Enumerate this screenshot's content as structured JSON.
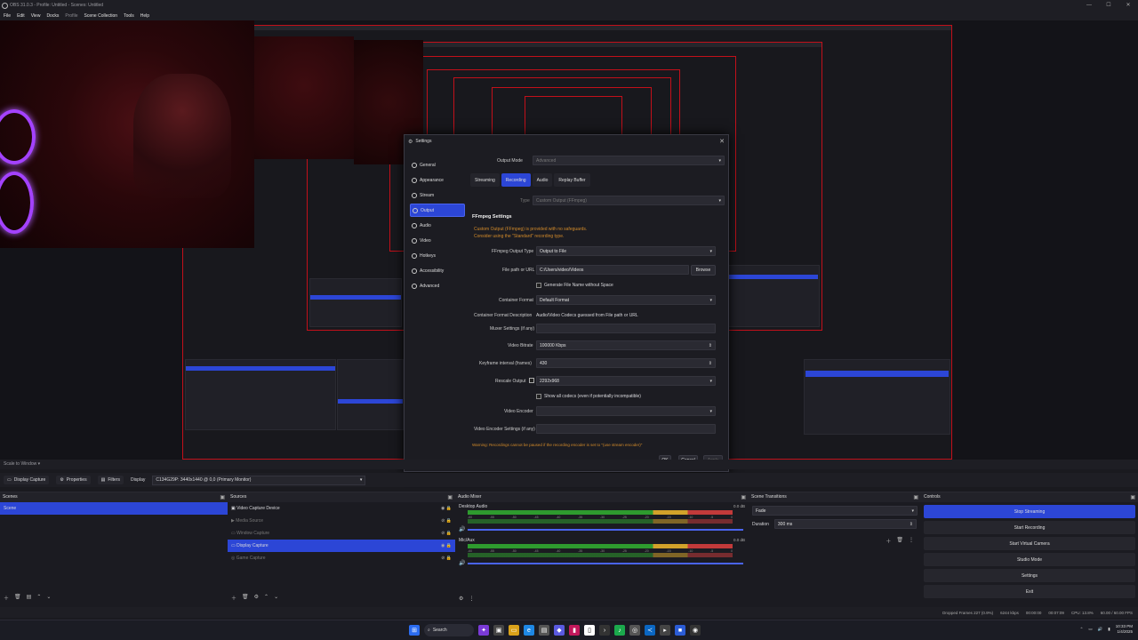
{
  "window": {
    "title": "OBS 31.0.3 - Profile: Untitled - Scenes: Untitled",
    "controls": [
      "—",
      "☐",
      "✕"
    ]
  },
  "menu": [
    {
      "label": "File"
    },
    {
      "label": "Edit"
    },
    {
      "label": "View"
    },
    {
      "label": "Docks"
    },
    {
      "label": "Profile",
      "dim": true
    },
    {
      "label": "Scene Collection"
    },
    {
      "label": "Tools"
    },
    {
      "label": "Help"
    }
  ],
  "settings": {
    "title": "Settings",
    "nav": [
      "General",
      "Appearance",
      "Stream",
      "Output",
      "Audio",
      "Video",
      "Hotkeys",
      "Accessibility",
      "Advanced"
    ],
    "active_nav": "Output",
    "output_mode_label": "Output Mode",
    "output_mode_value": "Advanced",
    "tabs": [
      "Streaming",
      "Recording",
      "Audio",
      "Replay Buffer"
    ],
    "active_tab": "Recording",
    "type_label": "Type",
    "type_value": "Custom Output (FFmpeg)",
    "section": "FFmpeg Settings",
    "warning1": "Custom Output (FFmpeg) is provided with no safeguards.",
    "warning2": "Consider using the \"Standard\" recording type.",
    "ffmpeg_output_type_label": "FFmpeg Output Type",
    "ffmpeg_output_type_value": "Output to File",
    "file_path_label": "File path or URL",
    "file_path_value": "C:/Users/video/Videos",
    "browse": "Browse",
    "gen_filename": "Generate File Name without Space",
    "container_format_label": "Container Format",
    "container_format_value": "Default Format",
    "container_desc_label": "Container Format Description",
    "container_desc_value": "Audio/Video Codecs guessed from File path or URL",
    "muxer_label": "Muxer Settings (if any)",
    "video_bitrate_label": "Video Bitrate",
    "video_bitrate_value": "100000 Kbps",
    "keyframe_label": "Keyframe interval (frames)",
    "keyframe_value": "430",
    "rescale_label": "Rescale Output",
    "rescale_value": "2292x968",
    "show_all_codecs": "Show all codecs (even if potentially incompatible)",
    "video_encoder_label": "Video Encoder",
    "video_encoder_settings_label": "Video Encoder Settings (if any)",
    "footer_warning": "Warning: Recordings cannot be paused if the recording encoder is set to \"(use stream encoder)\"",
    "ok": "OK",
    "cancel": "Cancel",
    "apply": "Apply"
  },
  "scale_label": "Scale to Window",
  "source_toolbar": {
    "source": "Display Capture",
    "properties": "Properties",
    "filters": "Filters",
    "display_label": "Display",
    "display_value": "C134G29P: 3440x1440 @ 0,0 (Primary Monitor)"
  },
  "scenes": {
    "title": "Scenes",
    "items": [
      "Scene"
    ]
  },
  "sources": {
    "title": "Sources",
    "items": [
      {
        "label": "Video Capture Device",
        "dim": false
      },
      {
        "label": "Media Source",
        "dim": true
      },
      {
        "label": "Window Capture",
        "dim": true
      },
      {
        "label": "Display Capture",
        "dim": false,
        "selected": true
      },
      {
        "label": "Game Capture",
        "dim": true
      }
    ]
  },
  "audio": {
    "title": "Audio Mixer",
    "channels": [
      {
        "name": "Desktop Audio",
        "db": "0.0 dB"
      },
      {
        "name": "Mic/Aux",
        "db": "0.0 dB"
      }
    ],
    "scale": [
      "-60",
      "-55",
      "-50",
      "-45",
      "-40",
      "-35",
      "-30",
      "-25",
      "-20",
      "-15",
      "-10",
      "-5",
      "0"
    ]
  },
  "transitions": {
    "title": "Scene Transitions",
    "value": "Fade",
    "duration_label": "Duration",
    "duration_value": "300 ms"
  },
  "controls": {
    "title": "Controls",
    "buttons": [
      "Stop Streaming",
      "Start Recording",
      "Start Virtual Camera",
      "Studio Mode",
      "Settings",
      "Exit"
    ]
  },
  "status": {
    "dropped": "Dropped Frames 227 (0.9%)",
    "kbps": "6244 kbps",
    "time1": "00:00:00",
    "time2": "00:07:09",
    "cpu": "CPU: 13.8%",
    "fps": "60.00 / 60.00 FPS"
  },
  "taskbar": {
    "search": "Search",
    "time": "10:33 PM",
    "date": "1/4/2025"
  }
}
